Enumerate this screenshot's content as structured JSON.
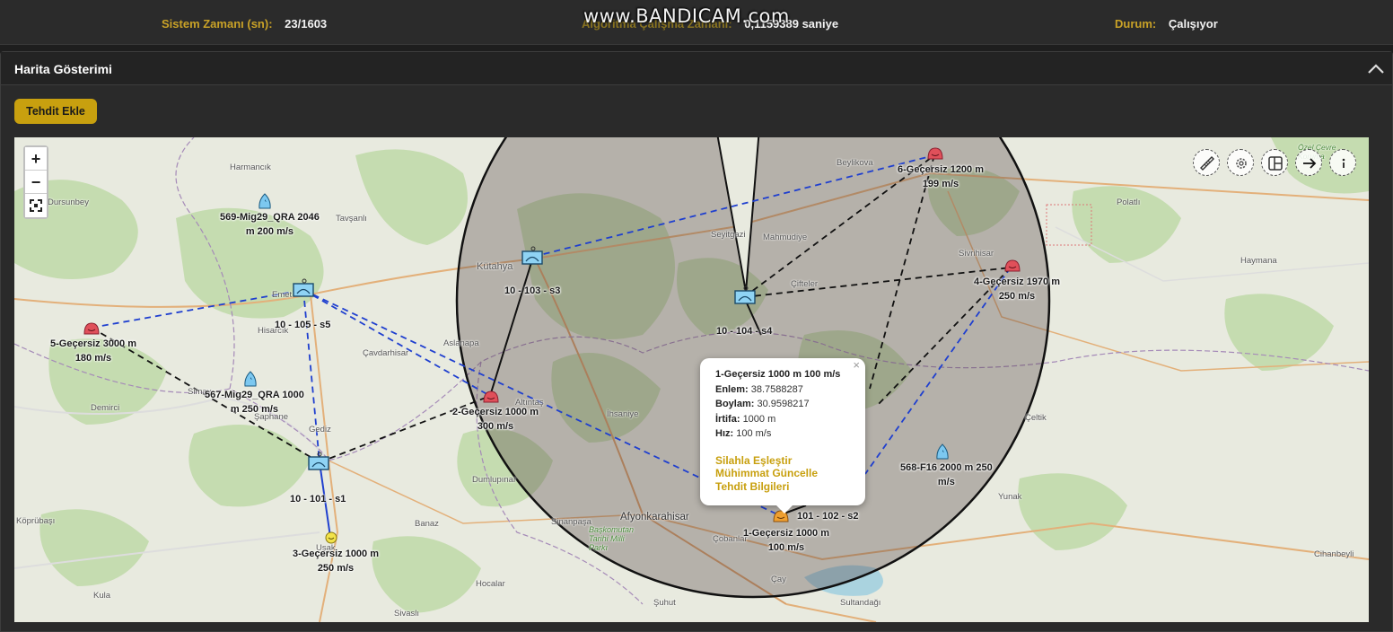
{
  "status": {
    "system_time_label": "Sistem Zamanı (sn):",
    "system_time_value": "23/1603",
    "algo_time_label": "Algoritma Çalışma Zamanı:",
    "algo_time_value": "0,1159389 saniye",
    "state_label": "Durum:",
    "state_value": "Çalışıyor"
  },
  "watermark": "www.BANDICAM.com",
  "panel": {
    "title": "Harita Gösterimi",
    "add_threat_button": "Tehdit Ekle"
  },
  "map_controls": {
    "zoom_in": "+",
    "zoom_out": "−",
    "tools": [
      "ruler-icon",
      "gear-icon",
      "layout-icon",
      "arrow-right-icon",
      "info-icon"
    ]
  },
  "systems": [
    {
      "id": "s1",
      "label": "10 - 101 - s1"
    },
    {
      "id": "s2",
      "label": "101 - 102 - s2"
    },
    {
      "id": "s3",
      "label": "10 - 103 - s3"
    },
    {
      "id": "s4",
      "label": "10 - 104 - s4"
    },
    {
      "id": "s5",
      "label": "10 - 105 - s5"
    }
  ],
  "threats": [
    {
      "id": "t1",
      "line1": "1-Geçersiz 1000 m",
      "line2": "100 m/s"
    },
    {
      "id": "t2",
      "line1": "2-Geçersiz 1000 m",
      "line2": "300 m/s"
    },
    {
      "id": "t3",
      "line1": "3-Geçersiz 1000 m",
      "line2": "250 m/s"
    },
    {
      "id": "t4",
      "line1": "4-Geçersiz 1970 m",
      "line2": "250 m/s"
    },
    {
      "id": "t5",
      "line1": "5-Geçersiz 3000 m",
      "line2": "180 m/s"
    },
    {
      "id": "t6",
      "line1": "6-Geçersiz 1200 m",
      "line2": "199 m/s"
    }
  ],
  "aircraft": [
    {
      "id": "a569",
      "line1": "569-Mig29_QRA 2046",
      "line2": "m 200 m/s"
    },
    {
      "id": "a567",
      "line1": "567-Mig29_QRA 1000",
      "line2": "m 250 m/s"
    },
    {
      "id": "a568",
      "line1": "568-F16 2000 m 250",
      "line2": "m/s"
    }
  ],
  "towns": [
    "Harmancık",
    "Dursunbey",
    "Tavşanlı",
    "Kütahya",
    "Emet",
    "Hisarcık",
    "Aslanapa",
    "Çavdarhisar",
    "Demirci",
    "Şaphane",
    "Gediz",
    "Simav",
    "Altıntaş",
    "İhsaniye",
    "Dumlupınar",
    "Köprübaşı",
    "Banaz",
    "Uşak",
    "Kula",
    "Sivaslı",
    "Hocalar",
    "Sinanpaşa",
    "Afyonkarahisar",
    "Başkomutan Tarihi Milli Parkı",
    "Şuhut",
    "Çobanlar",
    "Çay",
    "Sultandağı",
    "Seyitgazi",
    "Mahmudiye",
    "Çifteler",
    "Beylikova",
    "Sivrihisar",
    "Polatlı",
    "Haymana",
    "Yunak",
    "Çeltik",
    "Cihanbeyli",
    "Özel Çevre Koruma"
  ],
  "popup": {
    "title": "1-Geçersiz 1000 m 100 m/s",
    "lat_label": "Enlem:",
    "lat_value": "38.7588287",
    "lon_label": "Boylam:",
    "lon_value": "30.9598217",
    "alt_label": "İrtifa:",
    "alt_value": "1000 m",
    "speed_label": "Hız:",
    "speed_value": "100 m/s",
    "action_weapon": "Silahla Eşleştir",
    "action_ammo": "Mühimmat Güncelle",
    "action_info": "Tehdit Bilgileri",
    "close": "×"
  },
  "colors": {
    "accent": "#c8a00f",
    "threat": "#e0505a",
    "selected_threat": "#f0a030",
    "yellow_threat": "#f2e34a",
    "system": "#8fd3f4",
    "aircraft": "#7cc8f0",
    "assignment_line": "#1f3fcf",
    "pairing_line": "#111111"
  }
}
